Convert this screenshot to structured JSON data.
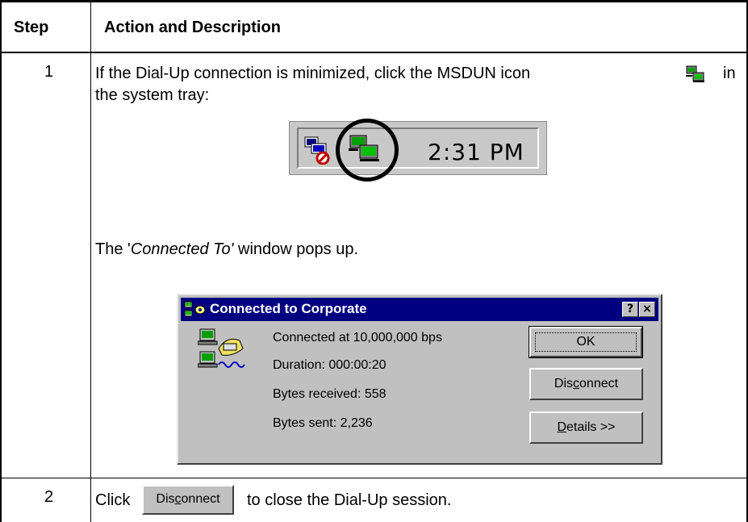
{
  "table": {
    "header_step": "Step",
    "header_action": "Action and Description"
  },
  "step1": {
    "number": "1",
    "intro_line1_before": "If the Dial-Up connection is minimized, click the MSDUN icon",
    "intro_line1_after": "in",
    "intro_line2": "the system tray:",
    "tray_time": "2:31 PM",
    "popup_before": "The '",
    "popup_italic": "Connected To'",
    "popup_after": " window pops up."
  },
  "dialog": {
    "title": "Connected to Corporate",
    "help_btn": "?",
    "close_btn": "×",
    "connected_at": "Connected at 10,000,000 bps",
    "duration": "Duration:  000:00:20",
    "bytes_received": "Bytes received:  558",
    "bytes_sent": "Bytes sent:  2,236",
    "ok_label": "OK",
    "disconnect_pre": "Dis",
    "disconnect_ul": "c",
    "disconnect_post": "onnect",
    "details_ul": "D",
    "details_post": "etails >>"
  },
  "step2": {
    "number": "2",
    "click_word": "Click",
    "button_pre": "Dis",
    "button_ul": "c",
    "button_post": "onnect",
    "after_text": "to close the Dial-Up session."
  },
  "icons": {
    "msdun": "network-computers-icon",
    "tray_net": "network-status-icon",
    "dialog_title": "dialup-connection-icon",
    "dialog_body": "modem-phone-icon"
  }
}
